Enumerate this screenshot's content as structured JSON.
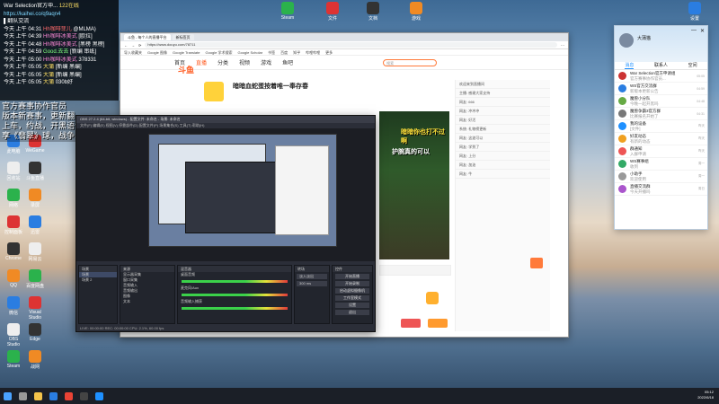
{
  "overlay": {
    "title": "War Selection官方申...",
    "title_count": "122在线",
    "link": "https://kaihei.co/q9aqn4",
    "channel": "翻队交流",
    "logs": [
      {
        "time": "今天 上午 04:31",
        "user": "Hh咖啡菲儿",
        "suffix": "@MLMA)",
        "cls": "red"
      },
      {
        "time": "今天 上午 04:39",
        "user": "Hh咖啡冰美式",
        "suffix": "[欧拉]",
        "cls": "pink"
      },
      {
        "time": "今天 上午 04:48",
        "user": "Hh咖啡冰美式",
        "suffix": "[黑榜 黑榜]",
        "cls": "pink"
      },
      {
        "time": "今天 上午 04:59",
        "user": "Good.去去",
        "suffix": "[新编 串纸]",
        "cls": "green"
      },
      {
        "time": "今天 上午 05:00",
        "user": "Hh咖啡冰美式",
        "suffix": "378331",
        "cls": "pink"
      },
      {
        "time": "今天 上午 05:05",
        "user": "大蒲",
        "suffix": "[新编 黑编]",
        "cls": "yellow"
      },
      {
        "time": "今天 上午 05:05",
        "user": "大蒲",
        "suffix": "[新编 黑编]",
        "cls": "yellow"
      },
      {
        "time": "今天 上午 05:05",
        "user": "大蒲",
        "suffix": "030b好",
        "cls": "yellow"
      }
    ]
  },
  "subtitle": {
    "lines": [
      "官方赛事协作官员",
      "版本新赛事，更新翻",
      "上车，约战，开黑语音，",
      "享《翡翠》球，战争与操择"
    ]
  },
  "browser": {
    "tabs": [
      "斗鱼 - 每个人的直播平台",
      "新标签页"
    ],
    "url": "https://www.douyu.com/78711",
    "bookmarks": [
      "导入收藏夹",
      "Google 图像",
      "Google Translate",
      "Google 学术搜索",
      "Google Scholar",
      "书签",
      "百度",
      "知乎",
      "哔哩哔哩",
      "更多"
    ],
    "site_logo": "斗鱼",
    "nav": [
      "首页",
      "直播",
      "分类",
      "视频",
      "游戏",
      "鱼吧"
    ],
    "search_placeholder": "搜索",
    "room_title": "暗暗血蛇蛋按着唯一奉存春",
    "danmu1": "暗暗你也打不过啊",
    "danmu2": "护腕真的可以",
    "chat_lines": [
      "欢迎来到直播间",
      "主播: 感谢大家支持",
      "网友: 666",
      "网友: 冲冲冲",
      "网友: 好活",
      "系统: 礼物榜更新",
      "网友: 这波可以",
      "网友: 学到了",
      "网友: 上分",
      "网友: 加油",
      "网友: 牛"
    ]
  },
  "obs": {
    "title": "OBS 27.2.4 (64-bit, windows) - 配置文件: 未命名 - 场景: 未命名",
    "menu": "文件(F)  编辑(E)  视图(V)  停靠部件(D)  配置文件(P)  场景集合(S)  工具(T)  帮助(H)",
    "docks": [
      "场景",
      "来源",
      "混音器",
      "转场",
      "控件"
    ],
    "scenes": [
      "场景",
      "场景 2"
    ],
    "sources": [
      "显示器采集",
      "窗口采集",
      "音频输入",
      "音频输出",
      "图像",
      "文本"
    ],
    "mixer": [
      "桌面音频",
      "麦克风/Aux",
      "音频输入捕获"
    ],
    "controls": [
      "开始直播",
      "开始录制",
      "启动虚拟摄像机",
      "工作室模式",
      "设置",
      "退出"
    ],
    "transition": "淡入淡出",
    "duration": "300 ms",
    "status": "LIVE: 00:00:00  REC: 00:00:00  CPU: 2.1%, 60.00 fps"
  },
  "qq": {
    "name": "大蒲猫",
    "tabs": [
      "消息",
      "联系人",
      "空间"
    ],
    "items": [
      {
        "name": "War Selection官方申请组",
        "sub": "官方赛事协作官员...",
        "time": "05:05",
        "color": "#c33"
      },
      {
        "name": "WS官方交流群",
        "sub": "新版本更新公告",
        "time": "04:59",
        "color": "#2a7de1"
      },
      {
        "name": "魔兽小分队",
        "sub": "今晚一起开黑吗",
        "time": "04:48",
        "color": "#6a4"
      },
      {
        "name": "魔兽争霸3官方群",
        "sub": "比赛报名开始了",
        "time": "04:31",
        "color": "#777"
      },
      {
        "name": "我的设备",
        "sub": "[文件]",
        "time": "昨天",
        "color": "#1e90ff"
      },
      {
        "name": "好友动态",
        "sub": "有新的动态",
        "time": "昨天",
        "color": "#f0a020"
      },
      {
        "name": "群通知",
        "sub": "入群申请",
        "time": "昨天",
        "color": "#e55"
      },
      {
        "name": "WS赛事组",
        "sub": "收到",
        "time": "周一",
        "color": "#3a6"
      },
      {
        "name": "小助手",
        "sub": "欢迎使用",
        "time": "周一",
        "color": "#999"
      },
      {
        "name": "直播交流群",
        "sub": "今天开播吗",
        "time": "周日",
        "color": "#a5c"
      }
    ]
  },
  "desktop_icons_left": [
    "此电脑",
    "回收站",
    "网络",
    "控制面板",
    "Chrome",
    "QQ",
    "微信",
    "OBS Studio",
    "Steam",
    "WeGame",
    "斗鱼直播",
    "录屏",
    "迅雷",
    "网易云",
    "百度网盘",
    "Visual Studio",
    "Edge",
    "战网"
  ],
  "desktop_icons_top": [
    "Steam",
    "文件",
    "文档",
    "游戏",
    "设置"
  ],
  "taskbar": {
    "time": "05:12",
    "date": "2022/6/18",
    "apps": [
      "start-icon",
      "search-icon",
      "explorer-icon",
      "edge-icon",
      "chrome-icon",
      "obs-icon",
      "qq-icon"
    ]
  }
}
